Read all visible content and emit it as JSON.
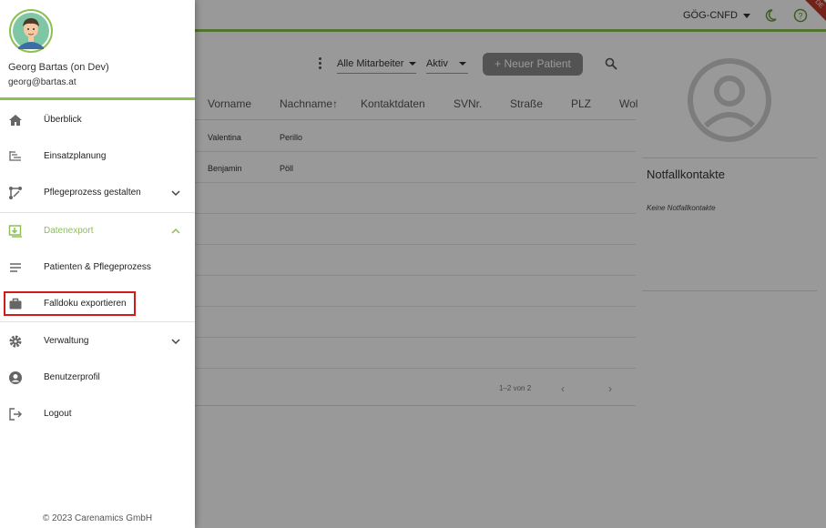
{
  "header": {
    "tenant": "GÖG-CNFD",
    "ribbon": "DE"
  },
  "toolbar": {
    "employee_filter": "Alle Mitarbeiter",
    "status_filter": "Aktiv",
    "new_patient_label": "+ Neuer Patient"
  },
  "table": {
    "columns": [
      "Vorname",
      "Nachname",
      "Kontaktdaten",
      "SVNr.",
      "Straße",
      "PLZ",
      "Wol"
    ],
    "sort_indicator": "↑",
    "rows": [
      {
        "vorname": "Valentina",
        "nachname": "Perillo"
      },
      {
        "vorname": "Benjamin",
        "nachname": "Pöll"
      }
    ],
    "pagination": "1–2 von 2"
  },
  "detail": {
    "emergency_title": "Notfallkontakte",
    "emergency_empty": "Keine Notfallkontakte"
  },
  "drawer": {
    "user_name": "Georg Bartas (on Dev)",
    "user_email": "georg@bartas.at",
    "items": [
      {
        "label": "Überblick",
        "icon": "home-icon"
      },
      {
        "label": "Einsatzplanung",
        "icon": "schedule-icon"
      },
      {
        "label": "Pflegeprozess gestalten",
        "icon": "process-icon"
      },
      {
        "label": "Datenexport",
        "icon": "export-icon"
      },
      {
        "label": "Patienten & Pflegeprozess",
        "icon": "list-icon"
      },
      {
        "label": "Falldoku exportieren",
        "icon": "briefcase-icon"
      },
      {
        "label": "Verwaltung",
        "icon": "gear-icon"
      },
      {
        "label": "Benutzerprofil",
        "icon": "account-icon"
      },
      {
        "label": "Logout",
        "icon": "logout-icon"
      }
    ],
    "footer": "© 2023 Carenamics GmbH"
  },
  "colors": {
    "accent": "#8cc152",
    "highlight": "#d11a1a"
  }
}
